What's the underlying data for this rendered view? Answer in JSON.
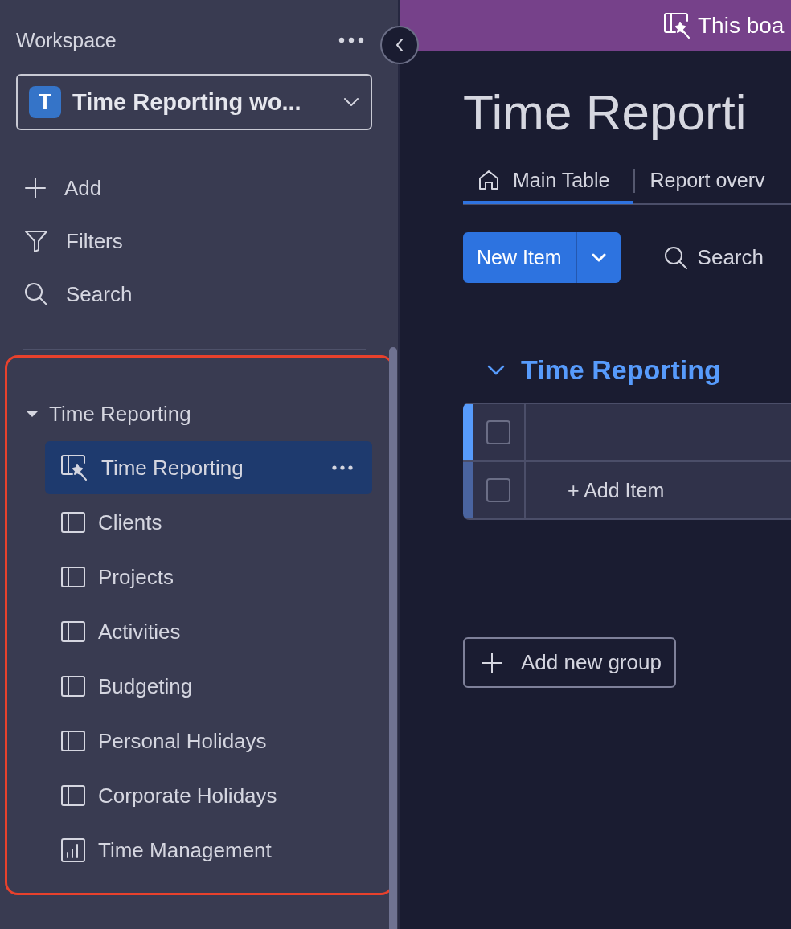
{
  "sidebar": {
    "title": "Workspace",
    "workspace": {
      "initial": "T",
      "name": "Time Reporting wo..."
    },
    "actions": [
      {
        "kind": "add",
        "label": "Add"
      },
      {
        "kind": "filter",
        "label": "Filters"
      },
      {
        "kind": "search",
        "label": "Search"
      }
    ],
    "folder": {
      "name": "Time Reporting",
      "expanded": true,
      "items": [
        {
          "kind": "ai-board",
          "label": "Time Reporting",
          "selected": true
        },
        {
          "kind": "board",
          "label": "Clients",
          "selected": false
        },
        {
          "kind": "board",
          "label": "Projects",
          "selected": false
        },
        {
          "kind": "board",
          "label": "Activities",
          "selected": false
        },
        {
          "kind": "board",
          "label": "Budgeting",
          "selected": false
        },
        {
          "kind": "board",
          "label": "Personal Holidays",
          "selected": false
        },
        {
          "kind": "board",
          "label": "Corporate Holidays",
          "selected": false
        },
        {
          "kind": "dashboard",
          "label": "Time Management",
          "selected": false
        }
      ]
    }
  },
  "banner": {
    "text": "This boa"
  },
  "board": {
    "title": "Time Reporti",
    "tabs": [
      {
        "kind": "home",
        "label": "Main Table",
        "selected": true
      },
      {
        "kind": "view",
        "label": "Report overv",
        "selected": false
      }
    ],
    "toolbar": {
      "new_item": "New Item",
      "search": "Search"
    },
    "group": {
      "name": "Time Reporting",
      "expanded": true,
      "rows": [
        {
          "kind": "item",
          "checked": false
        },
        {
          "kind": "add",
          "label": "+ Add Item",
          "checked": false
        }
      ]
    },
    "add_group": "Add new group"
  }
}
